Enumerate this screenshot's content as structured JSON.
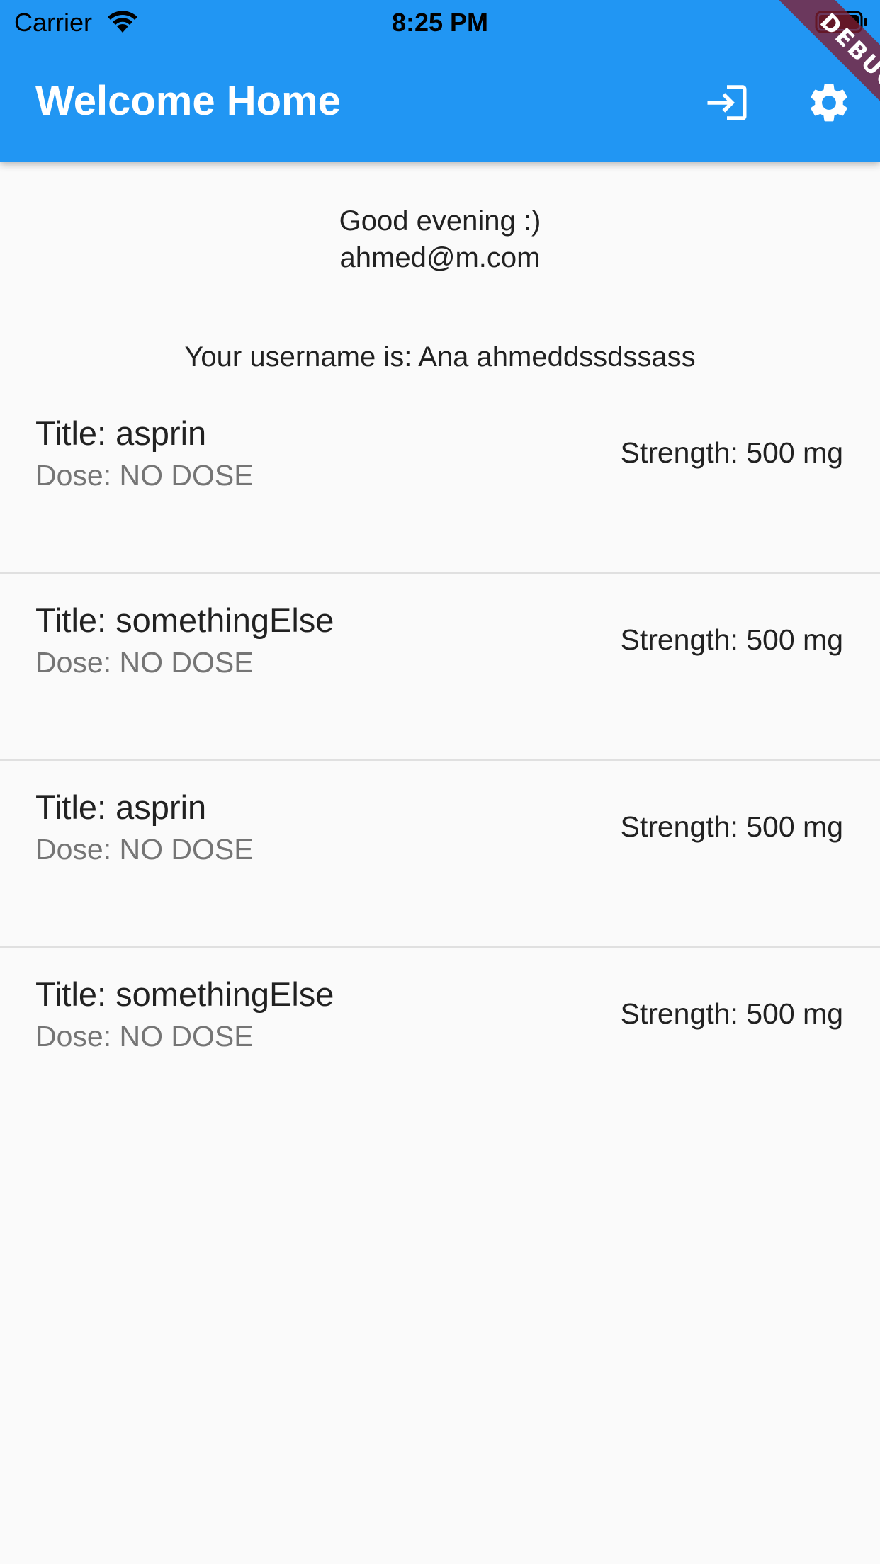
{
  "status_bar": {
    "carrier": "Carrier",
    "time": "8:25 PM",
    "icons": [
      "wifi-icon",
      "battery-icon"
    ]
  },
  "app_bar": {
    "title": "Welcome Home",
    "color": "#2196f3",
    "actions": [
      {
        "icon": "login-icon"
      },
      {
        "icon": "gear-icon"
      }
    ],
    "debug_banner": "DEBUG"
  },
  "greeting": {
    "message": "Good evening :)",
    "email": "ahmed@m.com"
  },
  "username_line": "Your username is: Ana ahmeddssdssass",
  "medications": [
    {
      "title": "Title: asprin",
      "dose": "Dose: NO DOSE",
      "strength": "Strength: 500 mg"
    },
    {
      "title": "Title: somethingElse",
      "dose": "Dose: NO DOSE",
      "strength": "Strength: 500 mg"
    },
    {
      "title": "Title: asprin",
      "dose": "Dose: NO DOSE",
      "strength": "Strength: 500 mg"
    },
    {
      "title": "Title: somethingElse",
      "dose": "Dose: NO DOSE",
      "strength": "Strength: 500 mg"
    }
  ]
}
